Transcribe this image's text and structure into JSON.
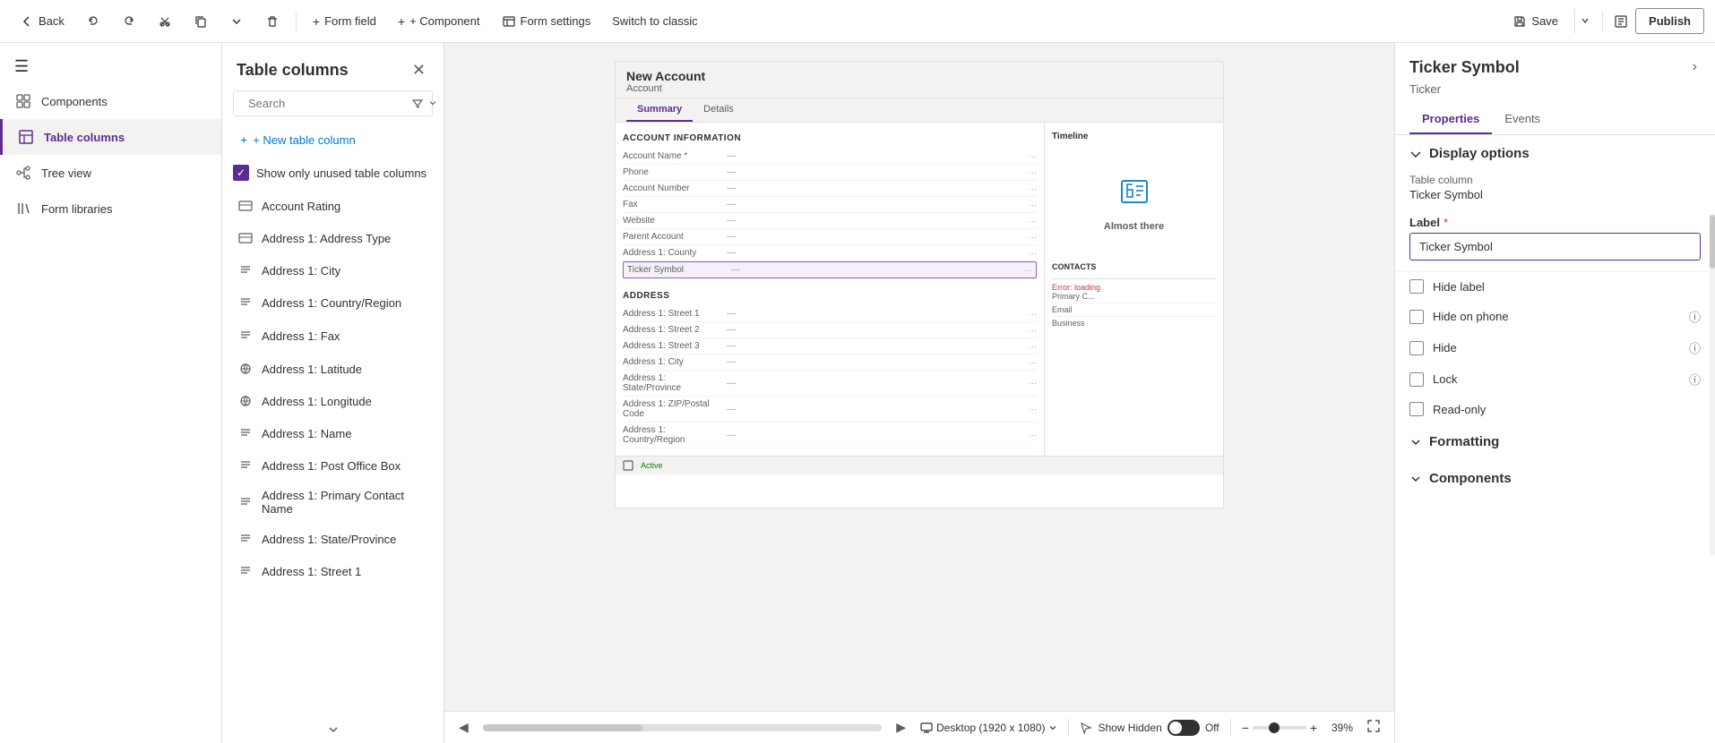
{
  "toolbar": {
    "back_label": "Back",
    "form_field_label": "Form field",
    "component_label": "+ Component",
    "form_settings_label": "Form settings",
    "switch_classic_label": "Switch to classic",
    "save_label": "Save",
    "publish_label": "Publish"
  },
  "left_nav": {
    "items": [
      {
        "id": "components",
        "label": "Components",
        "icon": "grid-icon"
      },
      {
        "id": "table-columns",
        "label": "Table columns",
        "icon": "table-icon",
        "active": true
      },
      {
        "id": "tree-view",
        "label": "Tree view",
        "icon": "tree-icon"
      },
      {
        "id": "form-libraries",
        "label": "Form libraries",
        "icon": "library-icon"
      }
    ]
  },
  "panel": {
    "title": "Table columns",
    "search_placeholder": "Search",
    "new_column_label": "+ New table column",
    "show_unused_label": "Show only unused table columns",
    "show_unused_checked": true,
    "items": [
      {
        "id": "account-rating",
        "label": "Account Rating",
        "icon": "list-icon"
      },
      {
        "id": "address-type",
        "label": "Address 1: Address Type",
        "icon": "list-icon"
      },
      {
        "id": "address-city",
        "label": "Address 1: City",
        "icon": "text-icon"
      },
      {
        "id": "address-country",
        "label": "Address 1: Country/Region",
        "icon": "text-icon"
      },
      {
        "id": "address-fax",
        "label": "Address 1: Fax",
        "icon": "text-icon",
        "has_more": true
      },
      {
        "id": "address-latitude",
        "label": "Address 1: Latitude",
        "icon": "globe-icon"
      },
      {
        "id": "address-longitude",
        "label": "Address 1: Longitude",
        "icon": "globe-icon"
      },
      {
        "id": "address-name",
        "label": "Address 1: Name",
        "icon": "text-icon"
      },
      {
        "id": "address-pobox",
        "label": "Address 1: Post Office Box",
        "icon": "text-icon"
      },
      {
        "id": "address-primary-contact",
        "label": "Address 1: Primary Contact Name",
        "icon": "text-icon"
      },
      {
        "id": "address-state",
        "label": "Address 1: State/Province",
        "icon": "text-icon"
      },
      {
        "id": "address-street1",
        "label": "Address 1: Street 1",
        "icon": "text-icon"
      }
    ]
  },
  "canvas": {
    "form_title": "New Account",
    "form_entity": "Account",
    "tabs": [
      {
        "id": "summary",
        "label": "Summary",
        "active": true
      },
      {
        "id": "details",
        "label": "Details"
      }
    ],
    "sections": {
      "account_info": {
        "header": "ACCOUNT INFORMATION",
        "fields": [
          {
            "label": "Account Name",
            "value": "—",
            "required": true
          },
          {
            "label": "Phone",
            "value": "—"
          },
          {
            "label": "Account Number",
            "value": "—"
          },
          {
            "label": "Fax",
            "value": "—"
          },
          {
            "label": "Website",
            "value": "—"
          },
          {
            "label": "Parent Account",
            "value": "—"
          },
          {
            "label": "Address 1: County",
            "value": "—"
          },
          {
            "label": "Ticker Symbol",
            "value": "—",
            "highlighted": true
          }
        ]
      },
      "address": {
        "header": "ADDRESS",
        "fields": [
          {
            "label": "Address 1: Street 1",
            "value": "—"
          },
          {
            "label": "Address 1: Street 2",
            "value": "—"
          },
          {
            "label": "Address 1: Street 3",
            "value": "—"
          },
          {
            "label": "Address 1: City",
            "value": "—"
          },
          {
            "label": "Address 1: State/Province",
            "value": "—"
          },
          {
            "label": "Address 1: ZIP/Postal Code",
            "value": "—"
          },
          {
            "label": "Address 1: Country/Region",
            "value": "—"
          }
        ]
      }
    },
    "timeline_label": "Timeline",
    "almost_there_text": "Almost there",
    "contacts_label": "CONTACTS",
    "status_label": "Active",
    "device_label": "Desktop (1920 x 1080)",
    "show_hidden_label": "Show Hidden",
    "toggle_state": "Off",
    "zoom_percent": "39%",
    "error_loading": "Error: loading"
  },
  "right_panel": {
    "title": "Ticker Symbol",
    "subtitle": "Ticker",
    "tabs": [
      {
        "id": "properties",
        "label": "Properties",
        "active": true
      },
      {
        "id": "events",
        "label": "Events"
      }
    ],
    "display_options": {
      "label": "Display options",
      "table_column_label": "Table column",
      "table_column_value": "Ticker Symbol"
    },
    "properties": {
      "label_field_label": "Label",
      "label_field_required": true,
      "label_field_value": "Ticker Symbol",
      "options": [
        {
          "id": "hide-label",
          "label": "Hide label",
          "info": false
        },
        {
          "id": "hide-on-phone",
          "label": "Hide on phone",
          "info": true
        },
        {
          "id": "hide",
          "label": "Hide",
          "info": true
        },
        {
          "id": "lock",
          "label": "Lock",
          "info": true
        },
        {
          "id": "read-only",
          "label": "Read-only",
          "info": false
        }
      ]
    },
    "formatting_label": "Formatting",
    "components_label": "Components"
  }
}
